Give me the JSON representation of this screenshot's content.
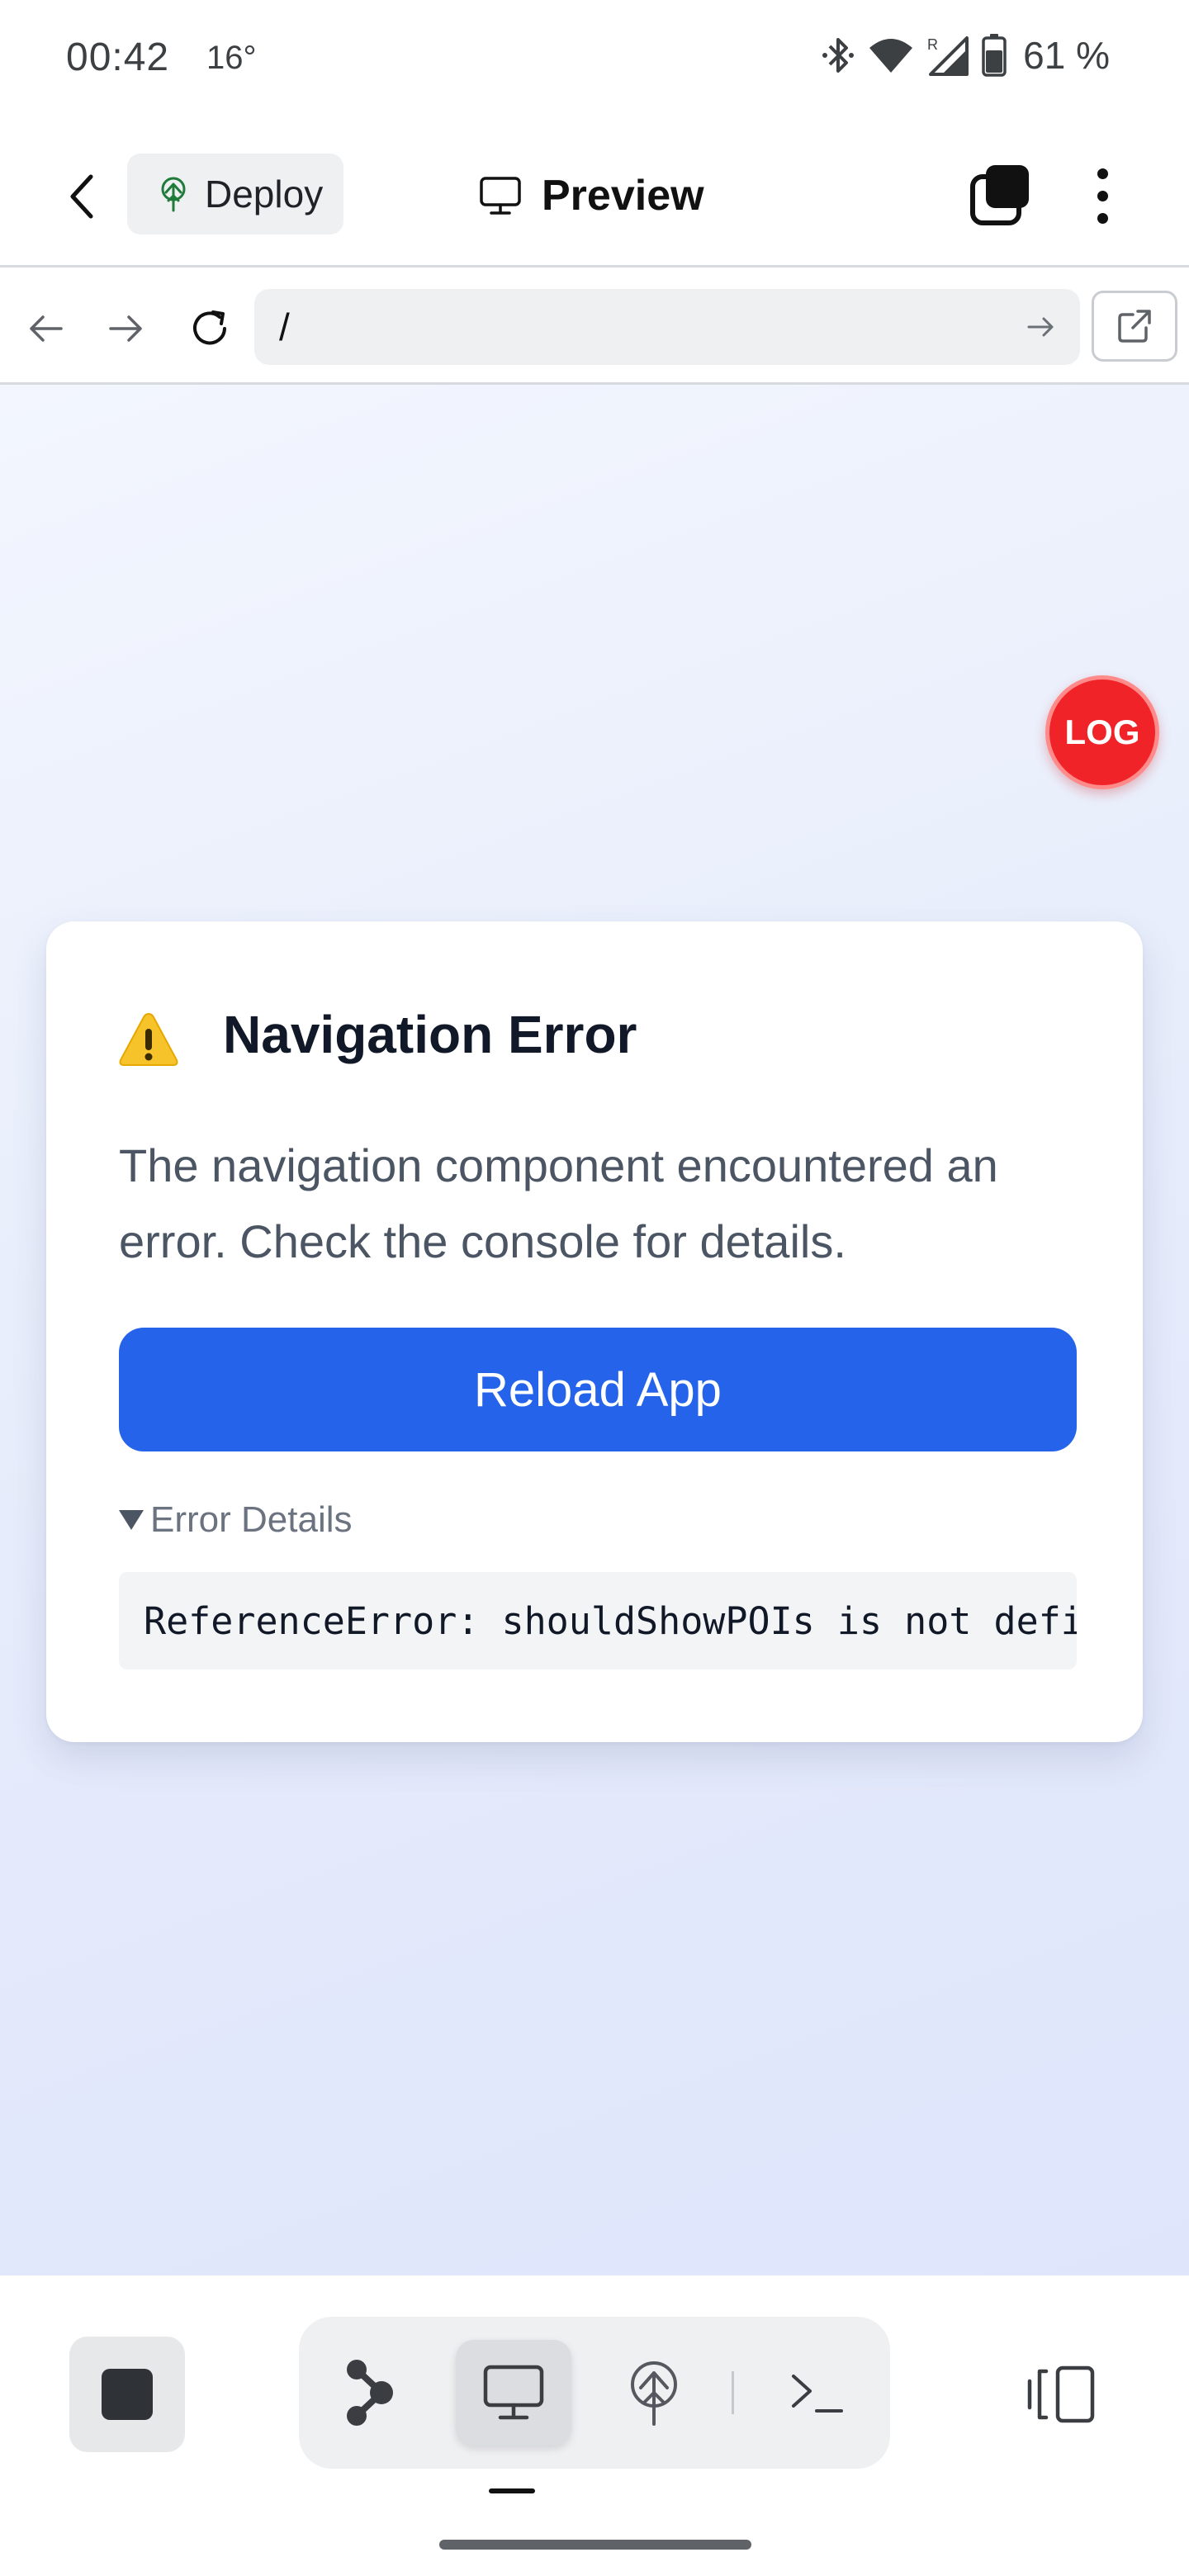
{
  "status_bar": {
    "time": "00:42",
    "temperature": "16°",
    "battery": "61 %",
    "icons": [
      "bluetooth-icon",
      "wifi-icon",
      "signal-roaming-icon",
      "battery-icon"
    ]
  },
  "app_bar": {
    "back_icon": "chevron-left-icon",
    "deploy_label": "Deploy",
    "deploy_icon": "deploy-tree-icon",
    "title": "Preview",
    "title_icon": "monitor-icon",
    "tabs_icon": "tabs-icon",
    "menu_icon": "more-vertical-icon"
  },
  "browser": {
    "url": "/",
    "back_icon": "arrow-left-icon",
    "forward_icon": "arrow-right-icon",
    "reload_icon": "reload-icon",
    "go_icon": "arrow-right-icon",
    "open_external_icon": "external-link-icon"
  },
  "content": {
    "log_button_label": "LOG",
    "error_card": {
      "icon": "warning-icon",
      "title": "Navigation Error",
      "message": "The navigation component encountered an error. Check the console for details.",
      "reload_button": "Reload App",
      "details_summary": "Error Details",
      "details_text": "ReferenceError: shouldShowPOIs is not defined"
    }
  },
  "bottom_bar": {
    "stop_icon": "stop-icon",
    "segments": [
      {
        "name": "graph",
        "icon": "graph-nodes-icon"
      },
      {
        "name": "preview",
        "icon": "monitor-icon",
        "selected": true
      },
      {
        "name": "deploy",
        "icon": "deploy-tree-icon"
      },
      {
        "name": "console",
        "icon": "terminal-icon"
      }
    ],
    "panel_icon": "side-panel-icon"
  },
  "colors": {
    "accent": "#2563eb",
    "log_red": "#f02428",
    "card_bg": "#ffffff",
    "content_bg": "#e6ecfb"
  }
}
